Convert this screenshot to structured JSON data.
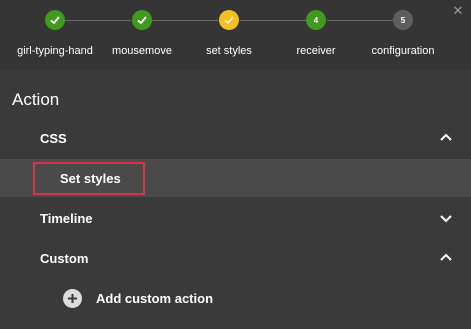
{
  "wizard": {
    "steps": [
      {
        "label": "girl-typing-hand",
        "state": "done",
        "number": ""
      },
      {
        "label": "mousemove",
        "state": "done",
        "number": ""
      },
      {
        "label": "set styles",
        "state": "current",
        "number": ""
      },
      {
        "label": "receiver",
        "state": "pending",
        "number": "4"
      },
      {
        "label": "configuration",
        "state": "pending",
        "number": "5"
      }
    ],
    "colors": {
      "done": "#3f9a1e",
      "current": "#f0c020",
      "pending_green": "#3f9a1e",
      "pending_gray": "#5e5e5e"
    }
  },
  "panel": {
    "title": "Action",
    "css_label": "CSS",
    "set_styles_label": "Set styles",
    "timeline_label": "Timeline",
    "custom_label": "Custom",
    "add_custom_label": "Add custom action"
  }
}
